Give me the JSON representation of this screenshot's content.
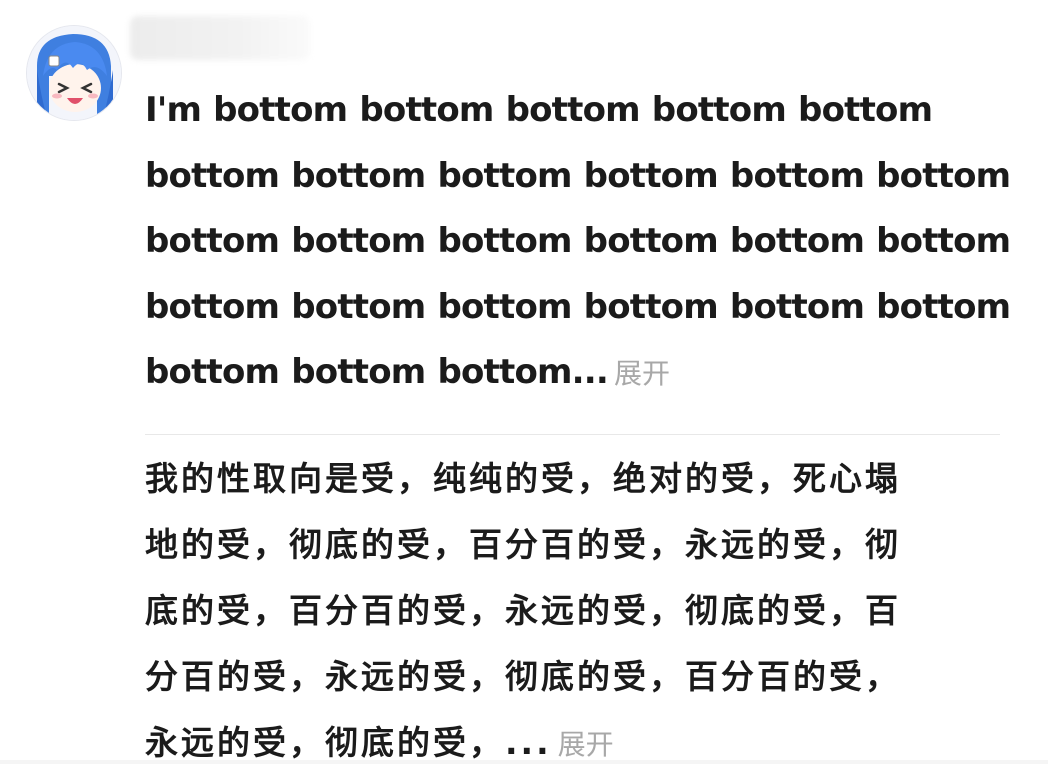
{
  "comment_1": {
    "lines": [
      "I'm bottom bottom bottom bottom bottom",
      "bottom bottom bottom bottom bottom bottom",
      "bottom bottom bottom bottom bottom bottom",
      "bottom bottom bottom bottom bottom bottom",
      "bottom bottom bottom..."
    ],
    "expand_label": "展开"
  },
  "comment_2": {
    "lines": [
      "我的性取向是受，纯纯的受，绝对的受，死心塌",
      "地的受，彻底的受，百分百的受，永远的受，彻",
      "底的受，百分百的受，永远的受，彻底的受，百",
      "分百的受，永远的受，彻底的受，百分百的受，",
      "永远的受，彻底的受，..."
    ],
    "expand_label": "展开"
  },
  "colors": {
    "text": "#1b1b1b",
    "expand": "#a8a8a8",
    "divider": "#e8e8e8",
    "avatar_hair": "#3f7fe0"
  },
  "icons": {
    "avatar": "anime-girl-avatar"
  }
}
